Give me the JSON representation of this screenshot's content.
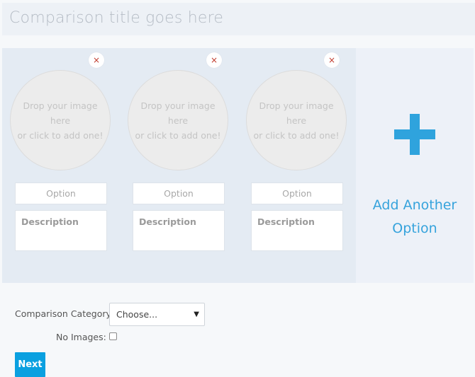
{
  "title_placeholder": "Comparison title goes here",
  "options": [
    {
      "remove_icon": "×",
      "image_prompt_line1": "Drop your image here",
      "image_prompt_line2": "or click to add one!",
      "option_placeholder": "Option",
      "description_placeholder": "Description"
    },
    {
      "remove_icon": "×",
      "image_prompt_line1": "Drop your image here",
      "image_prompt_line2": "or click to add one!",
      "option_placeholder": "Option",
      "description_placeholder": "Description"
    },
    {
      "remove_icon": "×",
      "image_prompt_line1": "Drop your image here",
      "image_prompt_line2": "or click to add one!",
      "option_placeholder": "Option",
      "description_placeholder": "Description"
    }
  ],
  "add_option": {
    "icon": "plus-icon",
    "label_line1": "Add Another",
    "label_line2": "Option"
  },
  "form": {
    "category_label": "Comparison Category:",
    "category_value": "Choose...",
    "no_images_label": "No Images:",
    "no_images_checked": false,
    "next_label": "Next"
  },
  "colors": {
    "accent": "#0aa0e0",
    "plus": "#2fa3dd",
    "remove": "#c0392b"
  }
}
